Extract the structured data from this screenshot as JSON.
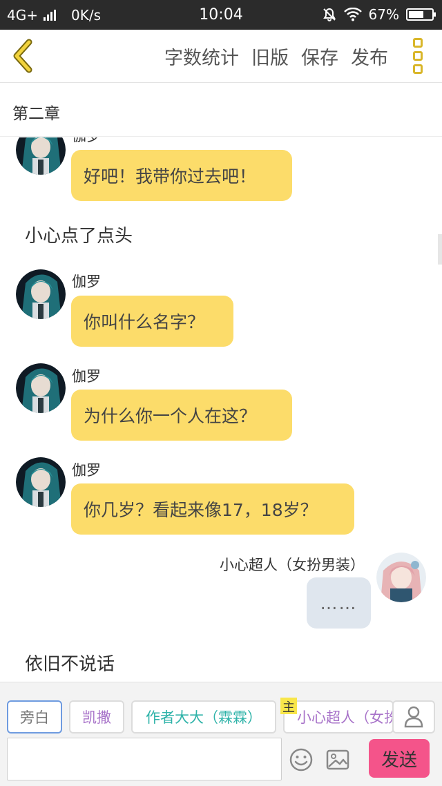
{
  "status_bar": {
    "network": "4G+",
    "speed": "0K/s",
    "time": "10:04",
    "battery": "67%",
    "battery_level": 0.67
  },
  "header": {
    "actions": [
      "字数统计",
      "旧版",
      "保存",
      "发布"
    ]
  },
  "chapter": {
    "title": "第二章"
  },
  "messages": [
    {
      "name": "伽罗",
      "text": "好吧！我带你过去吧！"
    },
    {
      "narration": "小心点了点头"
    },
    {
      "name": "伽罗",
      "text": "你叫什么名字？"
    },
    {
      "name": "伽罗",
      "text": "为什么你一个人在这？"
    },
    {
      "name": "伽罗",
      "text": "你几岁？看起来像17，18岁？"
    },
    {
      "name": "小心超人（女扮男装）",
      "text": "……"
    },
    {
      "narration": "依旧不说话"
    }
  ],
  "bottom": {
    "roles": [
      {
        "label": "旁白",
        "color": "#777777"
      },
      {
        "label": "凯撒",
        "color": "#a873c9"
      },
      {
        "label": "作者大大（霖霖）",
        "color": "#2fb3a9"
      },
      {
        "label": "小心超人（女扮男装）",
        "color": "#a873c9"
      }
    ],
    "host_badge": "主",
    "send_label": "发送"
  },
  "colors": {
    "bubble_yellow": "#fcdc6a",
    "bubble_gray": "#dfe6ee",
    "send_pink": "#f4548a",
    "accent_gold": "#d9b62a"
  }
}
